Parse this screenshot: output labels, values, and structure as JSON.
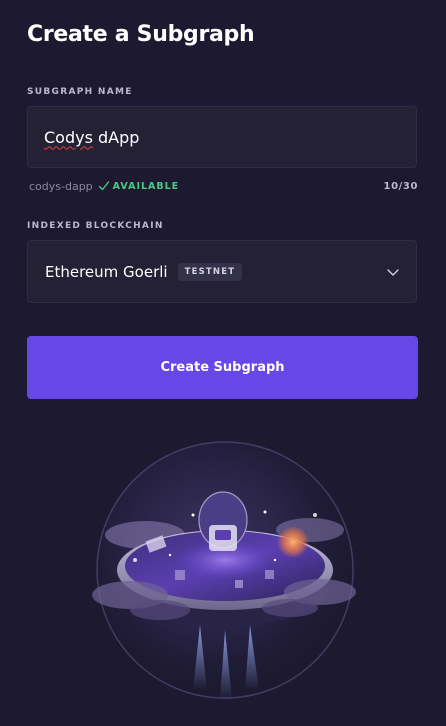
{
  "page": {
    "title": "Create a Subgraph"
  },
  "subgraph_name": {
    "label": "SUBGRAPH NAME",
    "value_part1": "Codys",
    "value_part2": " dApp",
    "slug": "codys-dapp",
    "availability": "AVAILABLE",
    "counter": "10/30"
  },
  "indexed_blockchain": {
    "label": "INDEXED BLOCKCHAIN",
    "selected_value": "Ethereum Goerli",
    "badge": "TESTNET"
  },
  "actions": {
    "create_label": "Create Subgraph"
  },
  "colors": {
    "background": "#1c1930",
    "field_background": "#242135",
    "primary_button": "#6748e6",
    "available_green": "#4bca81",
    "spellcheck_red": "#e0443c"
  },
  "icons": {
    "availability": "check-icon",
    "select": "chevron-down-icon"
  }
}
